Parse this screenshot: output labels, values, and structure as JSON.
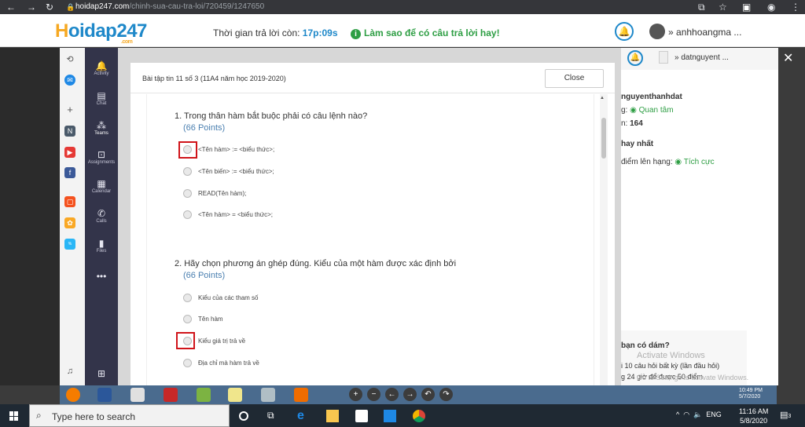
{
  "browser": {
    "url_host": "hoidap247.com",
    "url_path": "/chinh-sua-cau-tra-loi/720459/1247650"
  },
  "site": {
    "logo_h": "H",
    "logo_rest": "oidap247",
    "logo_com": ".com",
    "timer_label": "Thời gian trả lời còn:",
    "timer_value": "17p:09s",
    "tip": "Làm sao để có câu trả lời hay!",
    "username": "anhhoangma ..."
  },
  "teams_rail": [
    {
      "label": "Activity",
      "icon": "🔔"
    },
    {
      "label": "Chat",
      "icon": "▤"
    },
    {
      "label": "Teams",
      "icon": "⁂"
    },
    {
      "label": "Assignments",
      "icon": "⊡"
    },
    {
      "label": "Calendar",
      "icon": "▦"
    },
    {
      "label": "Calls",
      "icon": "✆"
    },
    {
      "label": "Files",
      "icon": "▮"
    },
    {
      "label": "",
      "icon": "•••"
    }
  ],
  "dialog": {
    "title": "Bài tập tin 11 số 3 (11A4 năm học 2019-2020)",
    "close_label": "Close"
  },
  "questions": [
    {
      "title": "1. Trong thân hàm bắt buộc phải có câu lệnh nào?",
      "points": "(66 Points)",
      "options": [
        "<Tên hàm> := <biểu thức>;",
        "<Tên biến> := <biểu thức>;",
        "READ(Tên hàm);",
        "<Tên hàm> = <biểu thức>;"
      ]
    },
    {
      "title": "2. Hãy chọn phương án ghép đúng. Kiểu của một hàm được xác định bởi",
      "points": "(66 Points)",
      "options": [
        "Kiểu của các tham số",
        "Tên hàm",
        "Kiểu giá trị trả về",
        "Địa chỉ mà hàm trả về"
      ]
    }
  ],
  "right_panel": {
    "username": "datnguyent ...",
    "name": "nguyenthanhdat",
    "follow_prefix": "g:",
    "follow": "Quan tâm",
    "score_prefix": "n:",
    "score": "164",
    "best": "hay nhất",
    "rank_label": "điểm lên hạng:",
    "rank": "Tích cực",
    "dare": "bạn có dám?",
    "line1": "i 10 câu hỏi bất kỳ (lần đầu hỏi)",
    "line2": "g 24 giờ để được 50 điểm",
    "watermark1": "Activate Windows",
    "watermark2": "Go to Settings to activate Windows."
  },
  "inner_taskbar": {
    "time": "10:49 PM",
    "date": "5/7/2020"
  },
  "taskbar": {
    "search_placeholder": "Type here to search",
    "lang": "ENG",
    "time": "11:16 AM",
    "date": "5/8/2020",
    "notif_count": "3"
  }
}
